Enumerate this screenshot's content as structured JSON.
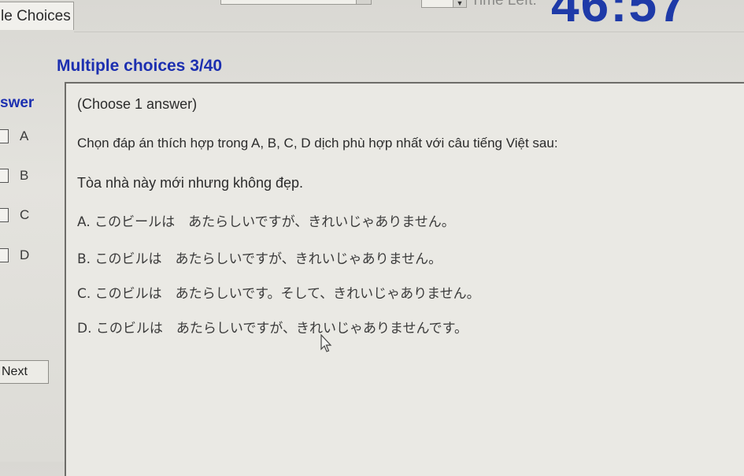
{
  "top": {
    "tab_label": "le Choices",
    "time_left_label": "Time Left:",
    "timer_value": "46:57"
  },
  "section": {
    "title": "Multiple choices 3/40"
  },
  "answer": {
    "header": "swer",
    "options": [
      "A",
      "B",
      "C",
      "D"
    ],
    "next_label": "Next"
  },
  "question": {
    "instruction": "(Choose 1 answer)",
    "prompt": "Chọn đáp án thích hợp trong A, B, C, D dịch phù hợp nhất với câu tiếng Việt sau:",
    "sentence": "Tòa nhà này mới nhưng không đẹp.",
    "choices": [
      "A. このビールは　あたらしいですが、きれいじゃありません。",
      "B. このビルは　あたらしいですが、きれいじゃありません。",
      "C. このビルは　あたらしいです。そして、きれいじゃありません。",
      "D. このビルは　あたらしいですが、きれいじゃありませんです。"
    ]
  }
}
